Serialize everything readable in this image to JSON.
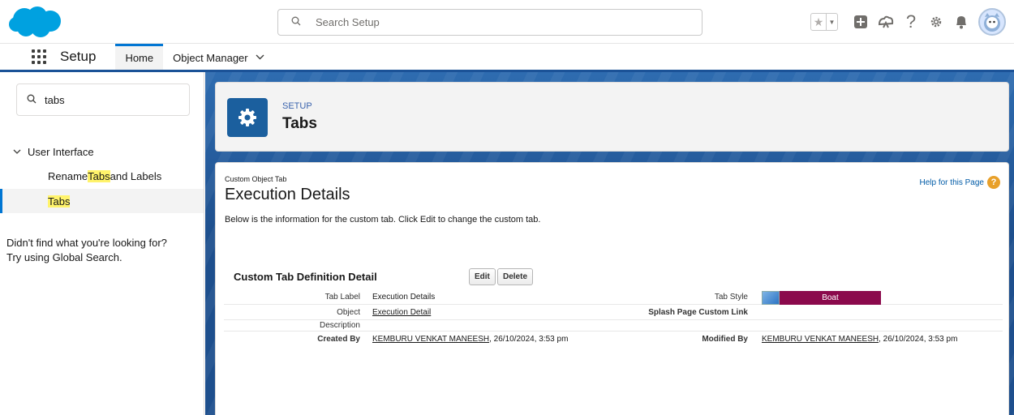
{
  "header": {
    "search_placeholder": "Search Setup",
    "help_glyph": "?",
    "icons": [
      "star-icon",
      "add-icon",
      "trailhead-icon",
      "help-icon",
      "gear-icon",
      "bell-icon",
      "avatar"
    ]
  },
  "nav": {
    "app_name": "Setup",
    "tabs": [
      {
        "label": "Home"
      },
      {
        "label": "Object Manager"
      }
    ]
  },
  "sidebar": {
    "quickfind_value": "tabs",
    "section": "User Interface",
    "items": [
      {
        "pre": "Rename ",
        "hl": "Tabs",
        "post": " and Labels"
      },
      {
        "pre": "",
        "hl": "Tabs",
        "post": ""
      }
    ],
    "help_line1": "Didn't find what you're looking for?",
    "help_line2": "Try using Global Search."
  },
  "page_header": {
    "kicker": "SETUP",
    "title": "Tabs"
  },
  "detail": {
    "kicker": "Custom Object Tab",
    "title": "Execution Details",
    "help_link": "Help for this Page",
    "help_glyph": "?",
    "description": "Below is the information for the custom tab. Click Edit to change the custom tab.",
    "section_title": "Custom Tab Definition Detail",
    "edit_label": "Edit",
    "delete_label": "Delete",
    "rows": {
      "tab_label": {
        "label": "Tab Label",
        "value": "Execution Details"
      },
      "tab_style": {
        "label": "Tab Style",
        "value": "Boat"
      },
      "object": {
        "label": "Object",
        "value": "Execution Detail"
      },
      "splash": {
        "label": "Splash Page Custom Link",
        "value": ""
      },
      "description": {
        "label": "Description",
        "value": ""
      },
      "created_by": {
        "label": "Created By",
        "user": "KEMBURU VENKAT MANEESH",
        "date": ", 26/10/2024, 3:53 pm"
      },
      "modified_by": {
        "label": "Modified By",
        "user": "KEMBURU VENKAT MANEESH",
        "date": ", 26/10/2024, 3:53 pm"
      }
    }
  },
  "colors": {
    "brand": "#0176d3",
    "tab_style_color": "#8b0a4c",
    "highlight": "#fff36b"
  }
}
